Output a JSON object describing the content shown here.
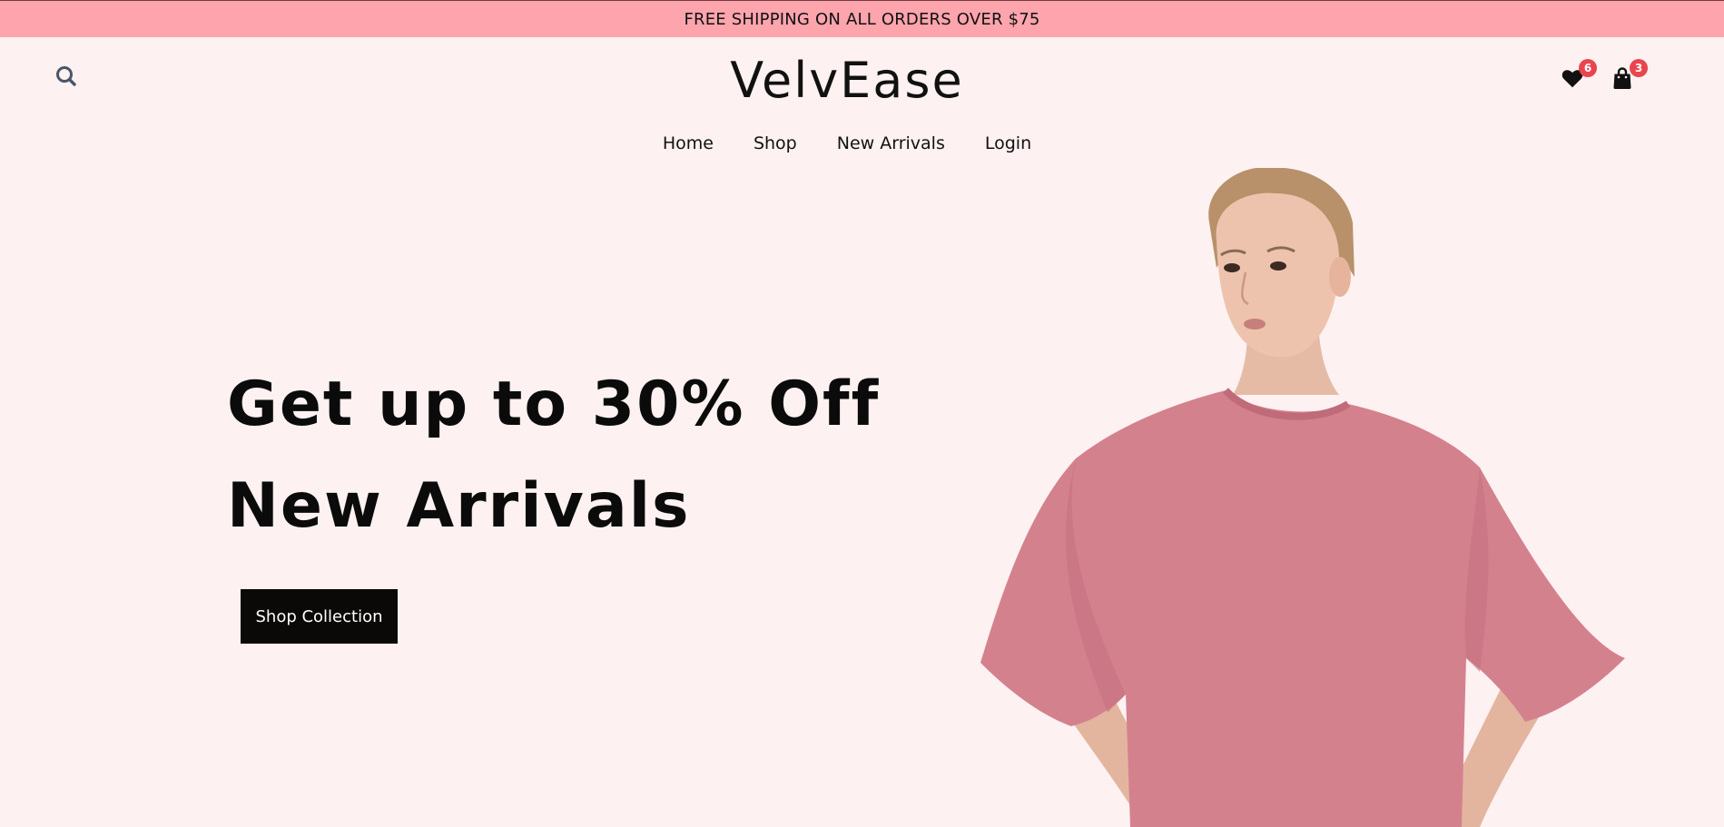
{
  "announcement": {
    "text": "FREE SHIPPING ON ALL ORDERS OVER $75"
  },
  "header": {
    "brand": "VelvEase",
    "search_icon": "search-icon",
    "wishlist": {
      "icon": "heart-icon",
      "count": "6"
    },
    "cart": {
      "icon": "shopping-bag-icon",
      "count": "3"
    }
  },
  "nav": {
    "items": [
      {
        "label": "Home"
      },
      {
        "label": "Shop"
      },
      {
        "label": "New Arrivals"
      },
      {
        "label": "Login"
      }
    ]
  },
  "hero": {
    "line1": "Get up to 30% Off",
    "line2": "New Arrivals",
    "cta_label": "Shop Collection",
    "image": "model-in-pink-oversized-tshirt"
  },
  "colors": {
    "announcement_bg": "#fda4ad",
    "page_bg": "#fdf1f1",
    "badge": "#e8454e",
    "button_bg": "#0a0908",
    "tshirt": "#d4818e"
  }
}
